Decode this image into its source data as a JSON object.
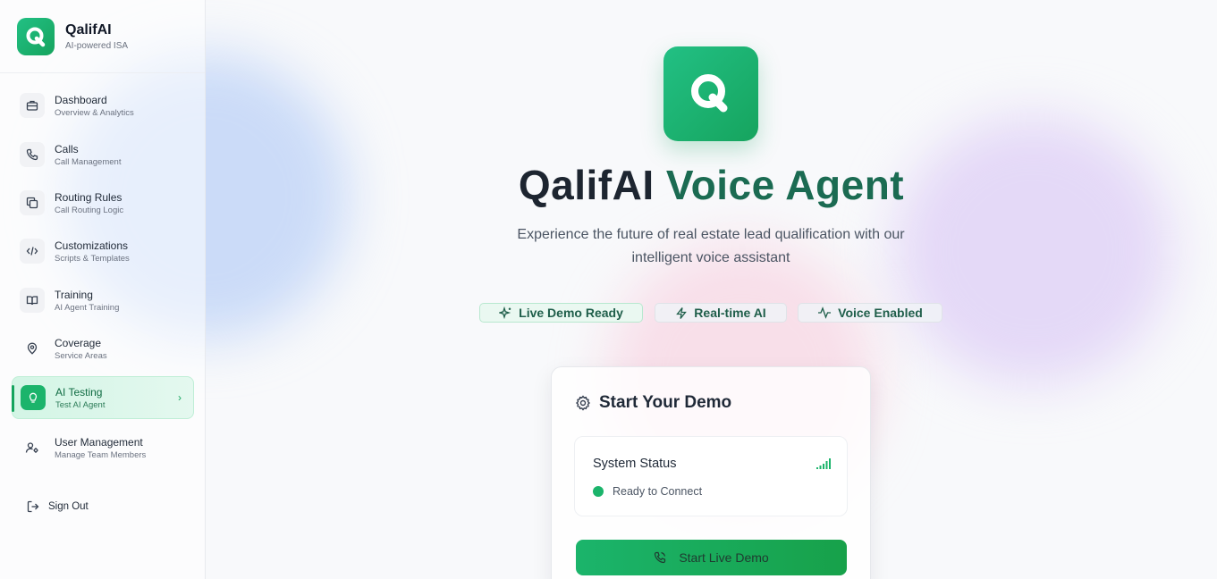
{
  "brand": {
    "name": "QalifAI",
    "tagline": "AI-powered ISA"
  },
  "sidebar": {
    "items": [
      {
        "label": "Dashboard",
        "sub": "Overview & Analytics",
        "icon": "briefcase-icon"
      },
      {
        "label": "Calls",
        "sub": "Call Management",
        "icon": "phone-icon"
      },
      {
        "label": "Routing Rules",
        "sub": "Call Routing Logic",
        "icon": "copy-icon"
      },
      {
        "label": "Customizations",
        "sub": "Scripts & Templates",
        "icon": "code-icon"
      },
      {
        "label": "Training",
        "sub": "AI Agent Training",
        "icon": "book-icon"
      },
      {
        "label": "Coverage",
        "sub": "Service Areas",
        "icon": "map-pin-icon"
      },
      {
        "label": "AI Testing",
        "sub": "Test AI Agent",
        "icon": "lightbulb-icon",
        "active": true
      },
      {
        "label": "User Management",
        "sub": "Manage Team Members",
        "icon": "user-cog-icon"
      }
    ],
    "signout": "Sign Out"
  },
  "hero": {
    "title_part1": "QalifAI",
    "title_part2": "Voice Agent",
    "description": "Experience the future of real estate lead qualification with our intelligent voice assistant"
  },
  "pills": [
    "Live Demo Ready",
    "Real-time AI",
    "Voice Enabled"
  ],
  "demo_card": {
    "title": "Start Your Demo",
    "status_title": "System Status",
    "status_text": "Ready to Connect",
    "button": "Start Live Demo"
  },
  "colors": {
    "accent": "#1bb46b",
    "accent_dark": "#16a45e",
    "title_green": "#1b6b52"
  }
}
